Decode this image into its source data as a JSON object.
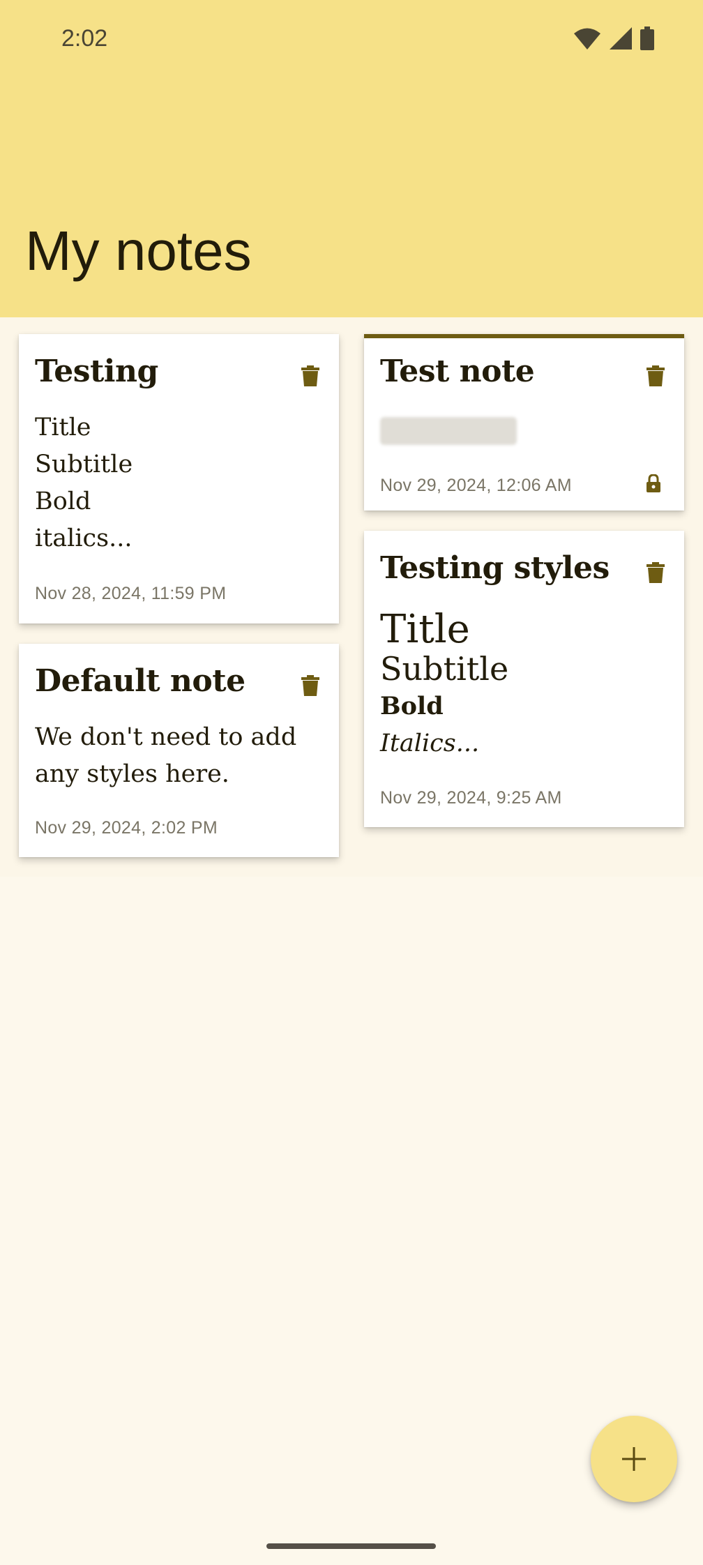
{
  "status_bar": {
    "time": "2:02"
  },
  "header": {
    "title": "My notes"
  },
  "notes": [
    {
      "title": "Testing",
      "body_lines": [
        "Title",
        "Subtitle",
        "Bold",
        "italics..."
      ],
      "date": "Nov 28, 2024, 11:59 PM"
    },
    {
      "title": "Test note",
      "body_redacted": true,
      "date": "Nov 29, 2024, 12:06 AM",
      "locked": true
    },
    {
      "title": "Default note",
      "body": "We don't need to add any styles here.",
      "date": "Nov 29, 2024, 2:02 PM"
    },
    {
      "title": "Testing styles",
      "styled_body": {
        "title": "Title",
        "subtitle": "Subtitle",
        "bold": "Bold",
        "italic": "Italics..."
      },
      "date": "Nov 29, 2024, 9:25 AM"
    }
  ],
  "fab": {
    "icon": "plus-icon"
  },
  "colors": {
    "app_bar": "#F6E188",
    "background": "#FDF8EC",
    "icon_accent": "#6E5C12",
    "text": "#221c0a"
  }
}
